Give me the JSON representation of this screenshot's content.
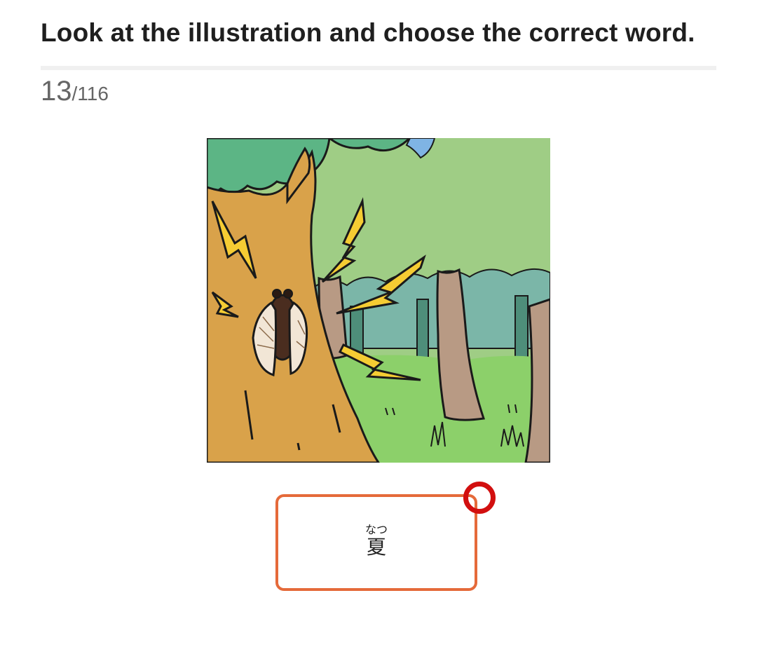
{
  "instruction": "Look at the illustration and choose the correct word.",
  "progress": {
    "current": "13",
    "separator": "/",
    "total": "116"
  },
  "illustration": {
    "subject": "cicada-on-tree"
  },
  "answer": {
    "furigana": "なつ",
    "word": "夏"
  },
  "colors": {
    "answer_border": "#e56a3a",
    "tap_indicator": "#d20f0f"
  }
}
